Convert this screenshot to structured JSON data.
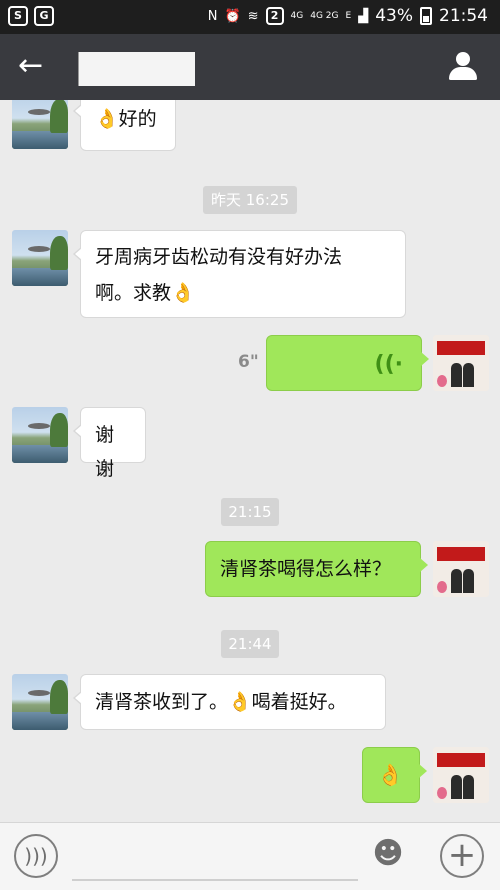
{
  "status_bar": {
    "app_icons": [
      "S",
      "Gaana"
    ],
    "sim_badge": "2",
    "network_a": "4G",
    "network_b": "4G 2G",
    "network_c": "E",
    "battery": "43%",
    "time": "21:54"
  },
  "header": {
    "back_icon": "back-arrow-icon",
    "profile_icon": "person-icon"
  },
  "messages": [
    {
      "side": "left",
      "text": "👌好的"
    },
    {
      "type": "time",
      "text": "昨天 16:25"
    },
    {
      "side": "left",
      "line1": "牙周病牙齿松动有没有好办法",
      "line2": "啊。求教👌"
    },
    {
      "side": "right",
      "type": "voice",
      "duration": "6\""
    },
    {
      "side": "left",
      "text": "谢谢"
    },
    {
      "type": "time",
      "text": "21:15"
    },
    {
      "side": "right",
      "text": "清肾茶喝得怎么样？"
    },
    {
      "type": "time",
      "text": "21:44"
    },
    {
      "side": "left",
      "text": "清肾茶收到了。👌喝着挺好。"
    },
    {
      "side": "right",
      "text": "👌"
    }
  ],
  "input_bar": {
    "voice_icon": "voice-icon",
    "emoji_icon": "smiley-icon",
    "plus_icon": "plus-icon",
    "placeholder": ""
  },
  "colors": {
    "accent_green": "#a0e75a",
    "topbar": "#393a3f",
    "background": "#ebebeb"
  }
}
